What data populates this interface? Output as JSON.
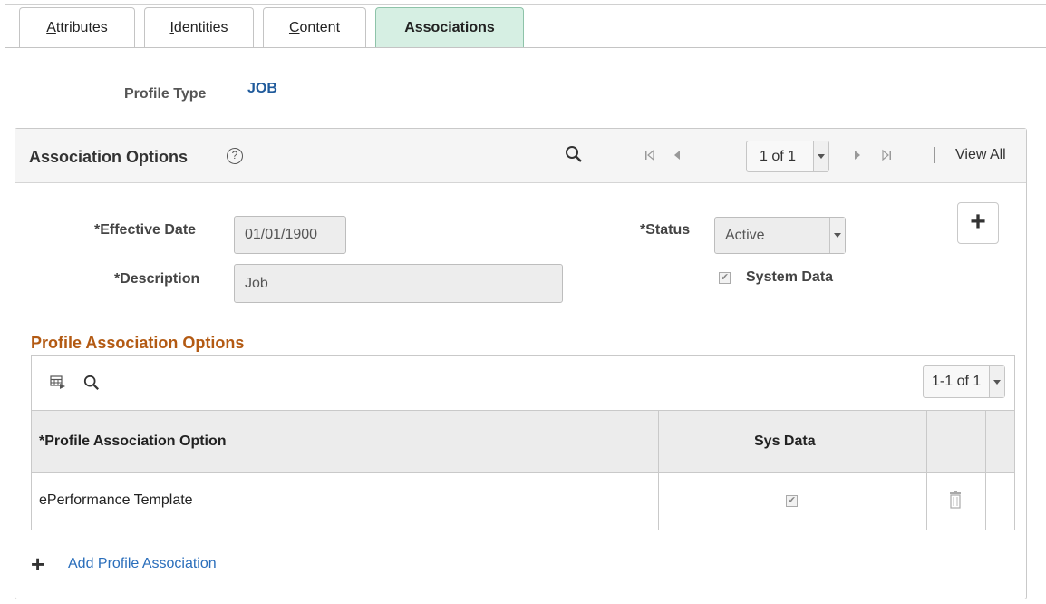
{
  "tabs": [
    {
      "label": "Attributes",
      "key": "A",
      "rest": "ttributes"
    },
    {
      "label": "Identities",
      "key": "I",
      "rest": "dentities"
    },
    {
      "label": "Content",
      "key": "C",
      "rest": "ontent"
    },
    {
      "label": "Associations",
      "active": true
    }
  ],
  "profile": {
    "type_label": "Profile Type",
    "type_value": "JOB"
  },
  "association_options": {
    "title": "Association Options",
    "pager": "1 of 1",
    "view_all": "View All",
    "effective_date_label": "*Effective Date",
    "effective_date": "01/01/1900",
    "description_label": "*Description",
    "description": "Job",
    "status_label": "*Status",
    "status": "Active",
    "system_data_label": "System Data",
    "system_data_checked": true
  },
  "profile_association_options": {
    "title": "Profile Association Options",
    "pager": "1-1 of 1",
    "columns": [
      "*Profile Association Option",
      "Sys Data"
    ],
    "rows": [
      {
        "option": "ePerformance Template",
        "sys_data": true
      }
    ],
    "add_label": "Add Profile Association"
  },
  "icons": {
    "search": "search-icon",
    "first": "first-page-icon",
    "prev": "previous-icon",
    "next": "next-icon",
    "last": "last-page-icon",
    "help": "help-icon",
    "add": "plus-icon",
    "grid": "personalize-grid-icon",
    "delete": "trash-icon",
    "check": "✔"
  }
}
